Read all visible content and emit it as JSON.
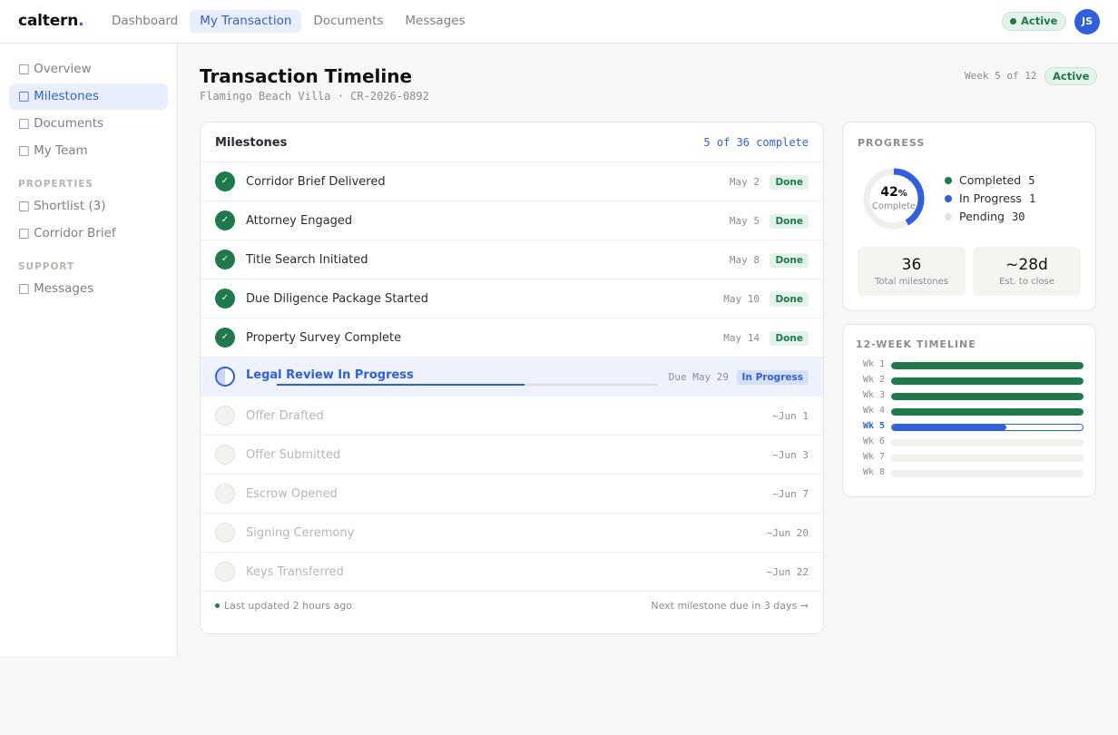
{
  "app": {
    "logo_text": "caltern",
    "logo_dot": "."
  },
  "nav": {
    "items": [
      {
        "label": "Dashboard",
        "active": false
      },
      {
        "label": "My Transaction",
        "active": true
      },
      {
        "label": "Documents",
        "active": false
      },
      {
        "label": "Messages",
        "active": false
      }
    ]
  },
  "status_pill": "Active",
  "user": {
    "initials": "JS"
  },
  "sidebar": {
    "items": [
      {
        "label": "Overview",
        "icon": "overview-icon",
        "active": false
      },
      {
        "label": "Milestones",
        "icon": "milestones-icon",
        "active": true
      },
      {
        "label": "Documents",
        "icon": "documents-icon",
        "active": false
      },
      {
        "label": "My Team",
        "icon": "team-icon",
        "active": false
      }
    ],
    "properties_heading": "PROPERTIES",
    "properties": [
      {
        "label": "Shortlist (3)",
        "icon": "shortlist-icon"
      },
      {
        "label": "Corridor Brief",
        "icon": "brief-icon"
      }
    ],
    "support_heading": "SUPPORT",
    "support": [
      {
        "label": "Messages",
        "icon": "messages-icon"
      }
    ],
    "icon_glyph": "□"
  },
  "header": {
    "title": "Transaction Timeline",
    "subtitle": "Flamingo Beach Villa · CR-2026-0892",
    "week_label": "Week 5 of 12",
    "week_status": "Active"
  },
  "milestones": {
    "title": "Milestones",
    "count_text": "5 of 36 complete",
    "done": [
      {
        "label": "Corridor Brief Delivered",
        "date": "May 2",
        "badge": "Done"
      },
      {
        "label": "Attorney Engaged",
        "date": "May 5",
        "badge": "Done"
      },
      {
        "label": "Title Search Initiated",
        "date": "May 8",
        "badge": "Done"
      },
      {
        "label": "Due Diligence Package Started",
        "date": "May 10",
        "badge": "Done"
      },
      {
        "label": "Property Survey Complete",
        "date": "May 14",
        "badge": "Done"
      }
    ],
    "current": {
      "label": "Legal Review In Progress",
      "date": "Due May 29",
      "badge": "In Progress",
      "progress": 0.65
    },
    "pending": [
      {
        "label": "Offer Drafted",
        "date": "~Jun 1"
      },
      {
        "label": "Offer Submitted",
        "date": "~Jun 3"
      },
      {
        "label": "Escrow Opened",
        "date": "~Jun 7"
      },
      {
        "label": "Signing Ceremony",
        "date": "~Jun 20"
      },
      {
        "label": "Keys Transferred",
        "date": "~Jun 22"
      }
    ],
    "check_glyph": "✓",
    "footer_left": "Last updated 2 hours ago",
    "footer_right": "Next milestone due in 3 days →"
  },
  "progress": {
    "heading": "PROGRESS",
    "percent": "42",
    "percent_sign": "%",
    "percent_value": 0.42,
    "complete_label": "Complete",
    "legend": [
      {
        "label": "Completed",
        "value": "5",
        "color": "#1e7a4a"
      },
      {
        "label": "In Progress",
        "value": "1",
        "color": "#2f5fe0"
      },
      {
        "label": "Pending",
        "value": "30",
        "color": "#e2e2df"
      }
    ],
    "stats": [
      {
        "value": "36",
        "label": "Total milestones"
      },
      {
        "value": "~28d",
        "label": "Est. to close"
      }
    ]
  },
  "timeline": {
    "heading": "12-WEEK TIMELINE",
    "weeks": [
      {
        "label": "Wk 1",
        "fill": 1.0,
        "state": "done"
      },
      {
        "label": "Wk 2",
        "fill": 1.0,
        "state": "done"
      },
      {
        "label": "Wk 3",
        "fill": 1.0,
        "state": "done"
      },
      {
        "label": "Wk 4",
        "fill": 1.0,
        "state": "done"
      },
      {
        "label": "Wk 5",
        "fill": 0.6,
        "state": "current"
      },
      {
        "label": "Wk 6",
        "fill": 0,
        "state": "pending"
      },
      {
        "label": "Wk 7",
        "fill": 0,
        "state": "pending"
      },
      {
        "label": "Wk 8",
        "fill": 0,
        "state": "pending"
      }
    ]
  },
  "colors": {
    "accent": "#2f5fe0",
    "success": "#1e7a4a"
  }
}
